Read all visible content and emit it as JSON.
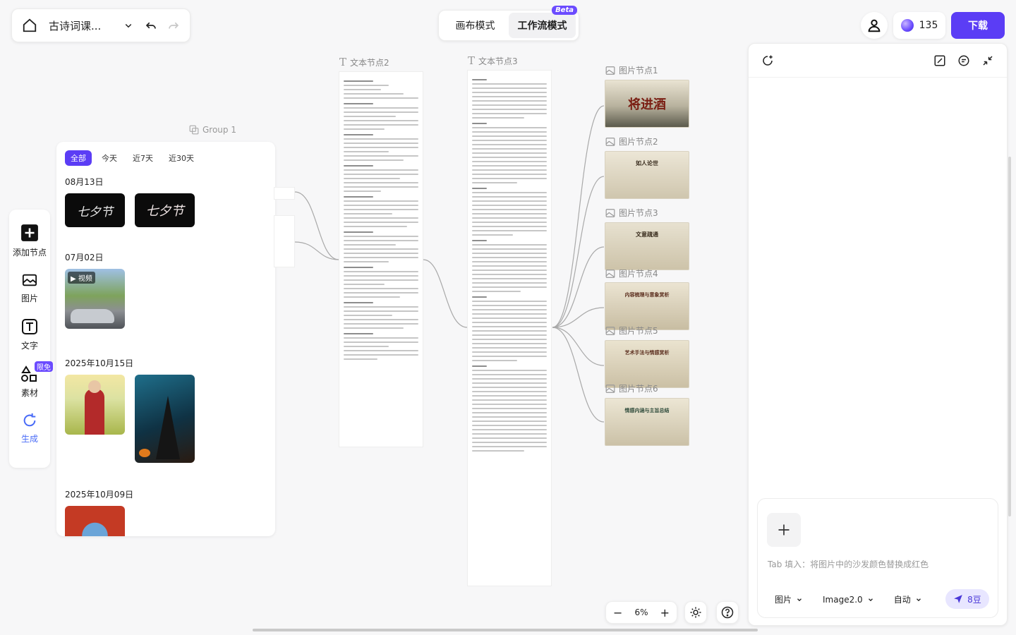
{
  "topbar": {
    "project_title": "古诗词课...",
    "modes": [
      "画布模式",
      "工作流模式"
    ],
    "beta_badge": "Beta",
    "credits": "135",
    "download_label": "下载"
  },
  "toolbar": {
    "items": [
      "添加节点",
      "图片",
      "文字",
      "素材",
      "生成"
    ],
    "limited_badge": "限免"
  },
  "history": {
    "filters": [
      "全部",
      "今天",
      "近7天",
      "近30天"
    ],
    "groups": [
      {
        "date": "08月13日",
        "items": [
          "七夕节",
          "七夕节"
        ]
      },
      {
        "date": "07月02日",
        "video_tag": "▶ 视频"
      },
      {
        "date": "2025年10月15日"
      },
      {
        "date": "2025年10月09日"
      }
    ]
  },
  "canvas": {
    "group_label": "Group 1",
    "text_nodes": [
      "文本节点2",
      "文本节点3"
    ],
    "image_nodes": [
      "图片节点1",
      "图片节点2",
      "图片节点3",
      "图片节点4",
      "图片节点5",
      "图片节点6"
    ],
    "image_titles": [
      "将进酒",
      "如人论世",
      "文意疏通",
      "内容梳理与意象赏析",
      "艺术手法与情感赏析",
      "情感内涵与主旨总结"
    ]
  },
  "zoom": {
    "level": "6%"
  },
  "panel": {
    "placeholder": "Tab 填入：将图片中的沙发颜色替换成红色",
    "options": [
      "图片",
      "Image2.0",
      "自动"
    ],
    "send_label": "8豆"
  }
}
